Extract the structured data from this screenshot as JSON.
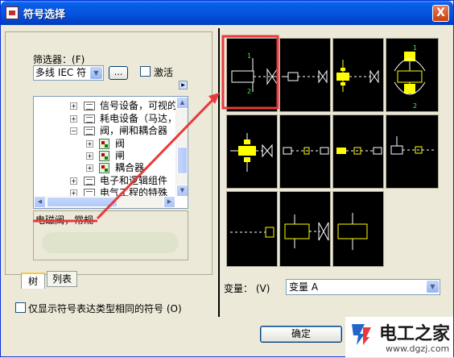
{
  "window": {
    "title": "符号选择",
    "close_label": "X"
  },
  "filter": {
    "label": "筛选器：",
    "hotkey": "(F)",
    "selected": "多线 IEC 符",
    "browse_label": "...",
    "activate_label": "激活"
  },
  "tree": {
    "items": [
      {
        "label": "信号设备，可视的",
        "level": 1
      },
      {
        "label": "耗电设备（马达，",
        "level": 1
      },
      {
        "label": "阀，闸和耦合器",
        "level": 1
      },
      {
        "label": "阀",
        "level": 2
      },
      {
        "label": "闸",
        "level": 2
      },
      {
        "label": "耦合器",
        "level": 2
      },
      {
        "label": "电子和逻辑组件",
        "level": 1
      },
      {
        "label": "电气工程的特殊",
        "level": 1
      }
    ]
  },
  "description": "电磁阀，常规",
  "tabs": {
    "tree": "树",
    "list": "列表"
  },
  "option": {
    "label": "仅显示符号表达类型相同的符号",
    "hotkey": "(O)"
  },
  "variant": {
    "label": "变量：",
    "hotkey": "(V)",
    "selected": "变量 A"
  },
  "ok_label": "确定",
  "watermark": {
    "title": "电工之家",
    "url": "www.dgzj.com"
  },
  "colors": {
    "title_bar": "#0a5fe8",
    "highlight": "#e8393b",
    "symbol_bg": "#000000",
    "symbol_line": "#ffffff",
    "symbol_accent": "#ffd800",
    "symbol_green": "#33ff33"
  }
}
